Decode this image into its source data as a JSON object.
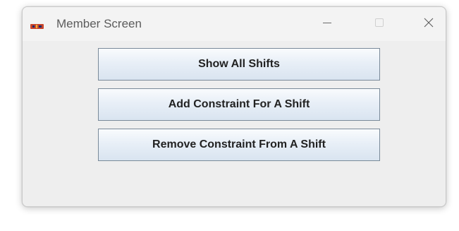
{
  "window": {
    "title": "Member Screen",
    "icons": {
      "app": "java-cup-icon",
      "minimize": "minimize-icon",
      "maximize": "maximize-icon",
      "close": "close-icon"
    }
  },
  "buttons": {
    "show_all_shifts": "Show All Shifts",
    "add_constraint": "Add Constraint For A Shift",
    "remove_constraint": "Remove Constraint From A Shift"
  },
  "colors": {
    "window_bg": "#f0f0f0",
    "button_border": "#7a8a99",
    "button_gradient_top": "#f9fbfd",
    "button_gradient_bottom": "#d9e4f0",
    "title_text": "#5c5c5c"
  }
}
